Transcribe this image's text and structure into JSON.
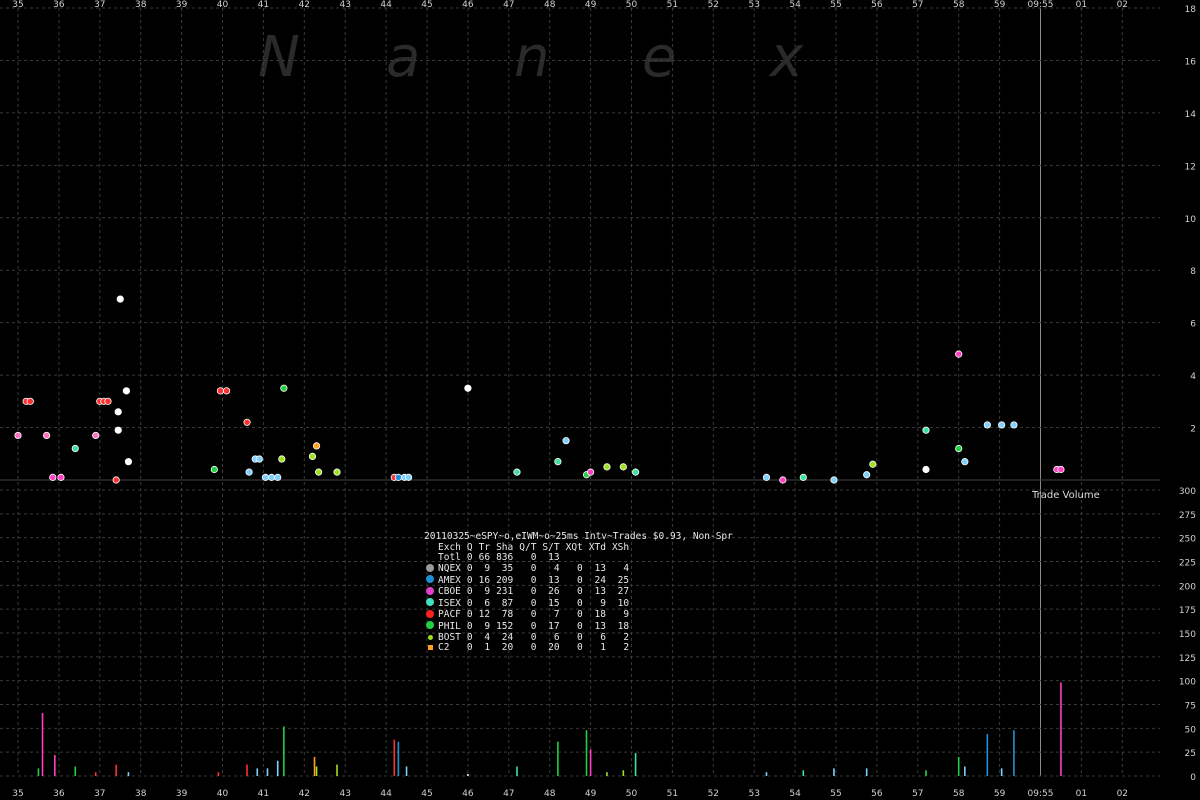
{
  "watermark": [
    "N",
    "a",
    "n",
    "e",
    "x"
  ],
  "series_label": "Trade Volume",
  "stats": {
    "title": "20110325~eSPY~o,eIWM~o~25ms Intv~Trades $0.93, Non-Spr",
    "columns": [
      "Exch",
      "Q",
      "Tr",
      "Sha",
      "Q/T",
      "S/T",
      "XQt",
      "XTd",
      "XSh"
    ],
    "rows": [
      {
        "name": "Totl",
        "color": "",
        "shape": "none",
        "vals": [
          "0",
          "66",
          "836",
          "0",
          "13",
          "",
          "",
          ""
        ]
      },
      {
        "name": "NQEX",
        "color": "#9a9a9a",
        "shape": "dot",
        "vals": [
          "0",
          "9",
          "35",
          "0",
          "4",
          "0",
          "13",
          "4"
        ]
      },
      {
        "name": "AMEX",
        "color": "#1e90d8",
        "shape": "dot",
        "vals": [
          "0",
          "16",
          "209",
          "0",
          "13",
          "0",
          "24",
          "25"
        ]
      },
      {
        "name": "CBOE",
        "color": "#e040c8",
        "shape": "dot",
        "vals": [
          "0",
          "9",
          "231",
          "0",
          "26",
          "0",
          "13",
          "27"
        ]
      },
      {
        "name": "ISEX",
        "color": "#40e0c0",
        "shape": "dot",
        "vals": [
          "0",
          "6",
          "87",
          "0",
          "15",
          "0",
          "9",
          "10"
        ]
      },
      {
        "name": "PACF",
        "color": "#ff2020",
        "shape": "dot",
        "vals": [
          "0",
          "12",
          "78",
          "0",
          "7",
          "0",
          "18",
          "9"
        ]
      },
      {
        "name": "PHIL",
        "color": "#20d040",
        "shape": "dot",
        "vals": [
          "0",
          "9",
          "152",
          "0",
          "17",
          "0",
          "13",
          "18"
        ]
      },
      {
        "name": "BOST",
        "color": "#a0e020",
        "shape": "small",
        "vals": [
          "0",
          "4",
          "24",
          "0",
          "6",
          "0",
          "6",
          "2"
        ]
      },
      {
        "name": "C2",
        "color": "#ffa020",
        "shape": "square",
        "vals": [
          "0",
          "1",
          "20",
          "0",
          "20",
          "0",
          "1",
          "2"
        ]
      }
    ]
  },
  "chart_data": [
    {
      "type": "scatter",
      "title": "",
      "ylim": [
        0,
        18
      ],
      "yticks": [
        "2",
        "4",
        "6",
        "8",
        "10",
        "12",
        "14",
        "16",
        "18"
      ],
      "xticks": [
        "35",
        "36",
        "37",
        "38",
        "39",
        "40",
        "41",
        "42",
        "43",
        "44",
        "45",
        "46",
        "47",
        "48",
        "49",
        "50",
        "51",
        "52",
        "53",
        "54",
        "55",
        "56",
        "57",
        "58",
        "59",
        "09:55",
        "01",
        "02"
      ],
      "points": [
        {
          "x": 35.0,
          "y": 1.7,
          "color": "#ff70c0"
        },
        {
          "x": 35.2,
          "y": 3.0,
          "color": "#ff3030"
        },
        {
          "x": 35.3,
          "y": 3.0,
          "color": "#ff3030"
        },
        {
          "x": 35.7,
          "y": 1.7,
          "color": "#ff70c0"
        },
        {
          "x": 35.85,
          "y": 0.1,
          "color": "#ff40c0"
        },
        {
          "x": 36.05,
          "y": 0.1,
          "color": "#ff40c0"
        },
        {
          "x": 36.4,
          "y": 1.2,
          "color": "#40e0a0"
        },
        {
          "x": 36.9,
          "y": 1.7,
          "color": "#ff70c0"
        },
        {
          "x": 37.0,
          "y": 3.0,
          "color": "#ff3030"
        },
        {
          "x": 37.1,
          "y": 3.0,
          "color": "#ff3030"
        },
        {
          "x": 37.2,
          "y": 3.0,
          "color": "#ff3030"
        },
        {
          "x": 37.4,
          "y": 0.0,
          "color": "#ff3030"
        },
        {
          "x": 37.45,
          "y": 1.9,
          "color": "#ffffff"
        },
        {
          "x": 37.45,
          "y": 2.6,
          "color": "#ffffff"
        },
        {
          "x": 37.5,
          "y": 6.9,
          "color": "#ffffff"
        },
        {
          "x": 37.65,
          "y": 3.4,
          "color": "#ffffff"
        },
        {
          "x": 37.7,
          "y": 0.7,
          "color": "#ffffff"
        },
        {
          "x": 39.8,
          "y": 0.4,
          "color": "#20d040"
        },
        {
          "x": 39.95,
          "y": 3.4,
          "color": "#ff3030"
        },
        {
          "x": 40.1,
          "y": 3.4,
          "color": "#ff3030"
        },
        {
          "x": 40.6,
          "y": 2.2,
          "color": "#ff3030"
        },
        {
          "x": 40.65,
          "y": 0.3,
          "color": "#7fd0ff"
        },
        {
          "x": 40.8,
          "y": 0.8,
          "color": "#7fd0ff"
        },
        {
          "x": 40.9,
          "y": 0.8,
          "color": "#7fd0ff"
        },
        {
          "x": 41.05,
          "y": 0.1,
          "color": "#7fd0ff"
        },
        {
          "x": 41.2,
          "y": 0.1,
          "color": "#7fd0ff"
        },
        {
          "x": 41.35,
          "y": 0.1,
          "color": "#7fd0ff"
        },
        {
          "x": 41.45,
          "y": 0.8,
          "color": "#a0e020"
        },
        {
          "x": 41.5,
          "y": 3.5,
          "color": "#20d040"
        },
        {
          "x": 42.2,
          "y": 0.9,
          "color": "#a0e020"
        },
        {
          "x": 42.3,
          "y": 1.3,
          "color": "#ffa020"
        },
        {
          "x": 42.35,
          "y": 0.3,
          "color": "#a0e020"
        },
        {
          "x": 42.8,
          "y": 0.3,
          "color": "#a0e020"
        },
        {
          "x": 44.2,
          "y": 0.1,
          "color": "#ff3030"
        },
        {
          "x": 44.3,
          "y": 0.1,
          "color": "#1e90d8"
        },
        {
          "x": 44.45,
          "y": 0.1,
          "color": "#7fd0ff"
        },
        {
          "x": 44.55,
          "y": 0.1,
          "color": "#7fd0ff"
        },
        {
          "x": 46.0,
          "y": 3.5,
          "color": "#ffffff"
        },
        {
          "x": 47.2,
          "y": 0.3,
          "color": "#40e0a0"
        },
        {
          "x": 48.2,
          "y": 0.7,
          "color": "#40e0a0"
        },
        {
          "x": 48.4,
          "y": 1.5,
          "color": "#7fd0ff"
        },
        {
          "x": 48.9,
          "y": 0.2,
          "color": "#20d040"
        },
        {
          "x": 49.0,
          "y": 0.3,
          "color": "#ff40c0"
        },
        {
          "x": 49.4,
          "y": 0.5,
          "color": "#a0e020"
        },
        {
          "x": 49.8,
          "y": 0.5,
          "color": "#a0e020"
        },
        {
          "x": 50.1,
          "y": 0.3,
          "color": "#40e0a0"
        },
        {
          "x": 53.3,
          "y": 0.1,
          "color": "#7fd0ff"
        },
        {
          "x": 53.7,
          "y": 0.0,
          "color": "#ff40c0"
        },
        {
          "x": 54.2,
          "y": 0.1,
          "color": "#40e0a0"
        },
        {
          "x": 54.95,
          "y": 0.0,
          "color": "#7fd0ff"
        },
        {
          "x": 55.75,
          "y": 0.2,
          "color": "#7fd0ff"
        },
        {
          "x": 55.9,
          "y": 0.6,
          "color": "#a0e020"
        },
        {
          "x": 57.2,
          "y": 0.4,
          "color": "#ffffff"
        },
        {
          "x": 57.2,
          "y": 1.9,
          "color": "#40e0a0"
        },
        {
          "x": 58.0,
          "y": 4.8,
          "color": "#ff40c0"
        },
        {
          "x": 58.0,
          "y": 1.2,
          "color": "#20d040"
        },
        {
          "x": 58.15,
          "y": 0.7,
          "color": "#7fd0ff"
        },
        {
          "x": 58.7,
          "y": 2.1,
          "color": "#7fd0ff"
        },
        {
          "x": 59.05,
          "y": 2.1,
          "color": "#7fd0ff"
        },
        {
          "x": 59.35,
          "y": 2.1,
          "color": "#7fd0ff"
        },
        {
          "x": 60.4,
          "y": 0.4,
          "color": "#ff40c0"
        },
        {
          "x": 60.5,
          "y": 0.4,
          "color": "#ff40c0"
        }
      ]
    },
    {
      "type": "bar",
      "name": "Trade Volume",
      "ylim": [
        0,
        300
      ],
      "yticks": [
        "0",
        "25",
        "50",
        "75",
        "100",
        "125",
        "150",
        "175",
        "200",
        "225",
        "250",
        "275",
        "300"
      ],
      "bars": [
        {
          "x": 35.5,
          "v": 8,
          "color": "#20d040"
        },
        {
          "x": 35.6,
          "v": 66,
          "color": "#ff40c0"
        },
        {
          "x": 35.9,
          "v": 22,
          "color": "#ff40c0"
        },
        {
          "x": 36.4,
          "v": 10,
          "color": "#20d040"
        },
        {
          "x": 36.9,
          "v": 4,
          "color": "#ff3030"
        },
        {
          "x": 37.4,
          "v": 12,
          "color": "#ff3030"
        },
        {
          "x": 37.7,
          "v": 4,
          "color": "#7fd0ff"
        },
        {
          "x": 39.9,
          "v": 4,
          "color": "#ff3030"
        },
        {
          "x": 40.6,
          "v": 12,
          "color": "#ff3030"
        },
        {
          "x": 40.85,
          "v": 8,
          "color": "#7fd0ff"
        },
        {
          "x": 41.1,
          "v": 8,
          "color": "#7fd0ff"
        },
        {
          "x": 41.35,
          "v": 16,
          "color": "#7fd0ff"
        },
        {
          "x": 41.5,
          "v": 52,
          "color": "#20d040"
        },
        {
          "x": 42.25,
          "v": 20,
          "color": "#ffa020"
        },
        {
          "x": 42.3,
          "v": 10,
          "color": "#a0e020"
        },
        {
          "x": 42.8,
          "v": 12,
          "color": "#a0e020"
        },
        {
          "x": 44.2,
          "v": 38,
          "color": "#ff3030"
        },
        {
          "x": 44.3,
          "v": 36,
          "color": "#1e90d8"
        },
        {
          "x": 44.5,
          "v": 10,
          "color": "#7fd0ff"
        },
        {
          "x": 46.0,
          "v": 2,
          "color": "#ffffff"
        },
        {
          "x": 47.2,
          "v": 10,
          "color": "#40e0a0"
        },
        {
          "x": 48.2,
          "v": 36,
          "color": "#20d040"
        },
        {
          "x": 48.9,
          "v": 48,
          "color": "#20d040"
        },
        {
          "x": 49.0,
          "v": 28,
          "color": "#ff40c0"
        },
        {
          "x": 49.4,
          "v": 4,
          "color": "#a0e020"
        },
        {
          "x": 49.8,
          "v": 6,
          "color": "#a0e020"
        },
        {
          "x": 50.1,
          "v": 24,
          "color": "#40e0a0"
        },
        {
          "x": 53.3,
          "v": 4,
          "color": "#7fd0ff"
        },
        {
          "x": 54.2,
          "v": 6,
          "color": "#40e0a0"
        },
        {
          "x": 54.95,
          "v": 8,
          "color": "#7fd0ff"
        },
        {
          "x": 55.75,
          "v": 8,
          "color": "#7fd0ff"
        },
        {
          "x": 57.2,
          "v": 6,
          "color": "#20d040"
        },
        {
          "x": 58.0,
          "v": 20,
          "color": "#20d040"
        },
        {
          "x": 58.15,
          "v": 10,
          "color": "#7fd0ff"
        },
        {
          "x": 58.7,
          "v": 44,
          "color": "#1e90d8"
        },
        {
          "x": 59.05,
          "v": 8,
          "color": "#7fd0ff"
        },
        {
          "x": 59.35,
          "v": 48,
          "color": "#1e90d8"
        },
        {
          "x": 60.5,
          "v": 98,
          "color": "#ff40c0"
        }
      ]
    }
  ]
}
